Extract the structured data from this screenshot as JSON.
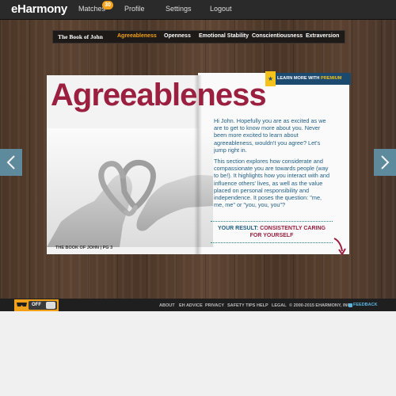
{
  "topbar": {
    "logo": "eHarmony",
    "nav": {
      "matches": "Matches",
      "matches_count": "30",
      "profile": "Profile",
      "settings": "Settings",
      "logout": "Logout"
    }
  },
  "chapters": {
    "items": [
      "The Book of John",
      "Agreeableness",
      "Openness",
      "Emotional Stability",
      "Conscientiousness",
      "Extraversion"
    ],
    "active": "Agreeableness"
  },
  "book": {
    "title": "Agreeableness",
    "page_label": "THE BOOK OF JOHN | PG 3",
    "premium_prefix": "LEARN MORE WITH ",
    "premium_word": "PREMIUM",
    "paragraph1": "Hi John. Hopefully you are as excited as we are to get to know more about you. Never been more excited to learn about agreeableness, wouldn't you agree? Let's jump right in.",
    "paragraph2": "This section explores how considerate and compassionate you are towards people (way to be!). It highlights how you interact with and influence others' lives, as well as the value placed on personal responsibility and independence. It poses the question: \"me, me, me\" or \"you, you, you\"?",
    "result_label": "YOUR RESULT: ",
    "result_value": "CONSISTENTLY CARING FOR YOURSELF"
  },
  "footer": {
    "toggle_label": "OFF",
    "links": [
      "ABOUT",
      "EH ADVICE",
      "PRIVACY",
      "SAFETY TIPS",
      "HELP",
      "LEGAL",
      "© 2000-2015 EHARMONY, INC."
    ],
    "feedback": "FEEDBACK"
  },
  "icons": {
    "prev": "chevron-left-icon",
    "next": "chevron-right-icon",
    "premium": "star-icon",
    "privacy": "mask-icon",
    "feedback": "feedback-icon"
  },
  "colors": {
    "accent": "#f4a11a",
    "title": "#9b1f3f",
    "text": "#1f5f86",
    "premium_bg": "#1c4a6e",
    "arrow": "#5f8fa3"
  }
}
